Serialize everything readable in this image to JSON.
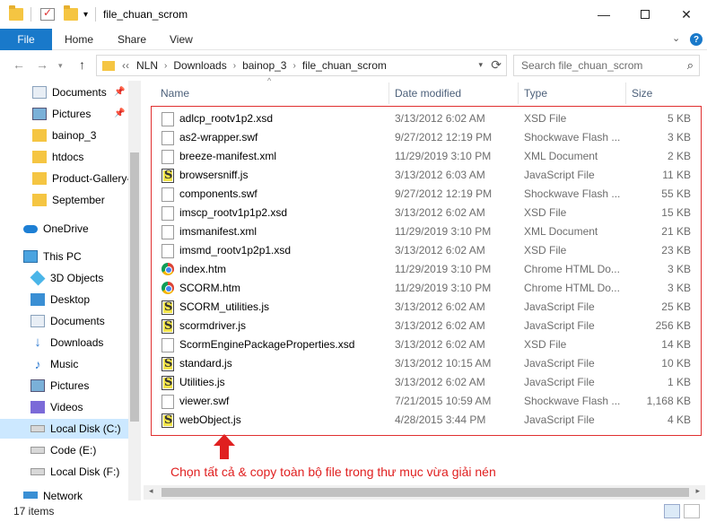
{
  "window": {
    "title": "file_chuan_scrom",
    "controls": {
      "minimize": "—",
      "close": "✕"
    }
  },
  "ribbon": {
    "file": "File",
    "tabs": [
      "Home",
      "Share",
      "View"
    ],
    "expand_icon": "chevron-down-icon",
    "help": "?"
  },
  "address": {
    "overflow": "‹‹",
    "crumbs": [
      "NLN",
      "Downloads",
      "bainop_3",
      "file_chuan_scrom"
    ]
  },
  "search": {
    "placeholder": "Search file_chuan_scrom"
  },
  "nav": {
    "items": [
      {
        "label": "Documents",
        "icon": "documents-icon",
        "pinned": true
      },
      {
        "label": "Pictures",
        "icon": "pictures-icon",
        "pinned": true
      },
      {
        "label": "bainop_3",
        "icon": "folder-icon"
      },
      {
        "label": "htdocs",
        "icon": "folder-icon"
      },
      {
        "label": "Product-Gallery-",
        "icon": "folder-icon"
      },
      {
        "label": "September",
        "icon": "folder-icon"
      },
      {
        "label": "OneDrive",
        "icon": "onedrive-icon"
      },
      {
        "label": "This PC",
        "icon": "this-pc-icon"
      },
      {
        "label": "3D Objects",
        "icon": "3d-objects-icon"
      },
      {
        "label": "Desktop",
        "icon": "desktop-icon"
      },
      {
        "label": "Documents",
        "icon": "documents-icon"
      },
      {
        "label": "Downloads",
        "icon": "downloads-icon"
      },
      {
        "label": "Music",
        "icon": "music-icon"
      },
      {
        "label": "Pictures",
        "icon": "pictures-icon"
      },
      {
        "label": "Videos",
        "icon": "videos-icon"
      },
      {
        "label": "Local Disk (C:)",
        "icon": "disk-icon",
        "selected": true
      },
      {
        "label": "Code (E:)",
        "icon": "disk-icon"
      },
      {
        "label": "Local Disk (F:)",
        "icon": "disk-icon"
      },
      {
        "label": "Network",
        "icon": "network-icon"
      }
    ]
  },
  "columns": {
    "name": "Name",
    "date": "Date modified",
    "type": "Type",
    "size": "Size"
  },
  "files": [
    {
      "name": "adlcp_rootv1p2.xsd",
      "date": "3/13/2012 6:02 AM",
      "type": "XSD File",
      "size": "5 KB",
      "icon": "document-icon"
    },
    {
      "name": "as2-wrapper.swf",
      "date": "9/27/2012 12:19 PM",
      "type": "Shockwave Flash ...",
      "size": "3 KB",
      "icon": "document-icon"
    },
    {
      "name": "breeze-manifest.xml",
      "date": "11/29/2019 3:10 PM",
      "type": "XML Document",
      "size": "2 KB",
      "icon": "document-icon"
    },
    {
      "name": "browsersniff.js",
      "date": "3/13/2012 6:03 AM",
      "type": "JavaScript File",
      "size": "11 KB",
      "icon": "js-file-icon"
    },
    {
      "name": "components.swf",
      "date": "9/27/2012 12:19 PM",
      "type": "Shockwave Flash ...",
      "size": "55 KB",
      "icon": "document-icon"
    },
    {
      "name": "imscp_rootv1p1p2.xsd",
      "date": "3/13/2012 6:02 AM",
      "type": "XSD File",
      "size": "15 KB",
      "icon": "document-icon"
    },
    {
      "name": "imsmanifest.xml",
      "date": "11/29/2019 3:10 PM",
      "type": "XML Document",
      "size": "21 KB",
      "icon": "document-icon"
    },
    {
      "name": "imsmd_rootv1p2p1.xsd",
      "date": "3/13/2012 6:02 AM",
      "type": "XSD File",
      "size": "23 KB",
      "icon": "document-icon"
    },
    {
      "name": "index.htm",
      "date": "11/29/2019 3:10 PM",
      "type": "Chrome HTML Do...",
      "size": "3 KB",
      "icon": "chrome-icon"
    },
    {
      "name": "SCORM.htm",
      "date": "11/29/2019 3:10 PM",
      "type": "Chrome HTML Do...",
      "size": "3 KB",
      "icon": "chrome-icon"
    },
    {
      "name": "SCORM_utilities.js",
      "date": "3/13/2012 6:02 AM",
      "type": "JavaScript File",
      "size": "25 KB",
      "icon": "js-file-icon"
    },
    {
      "name": "scormdriver.js",
      "date": "3/13/2012 6:02 AM",
      "type": "JavaScript File",
      "size": "256 KB",
      "icon": "js-file-icon"
    },
    {
      "name": "ScormEnginePackageProperties.xsd",
      "date": "3/13/2012 6:02 AM",
      "type": "XSD File",
      "size": "14 KB",
      "icon": "document-icon"
    },
    {
      "name": "standard.js",
      "date": "3/13/2012 10:15 AM",
      "type": "JavaScript File",
      "size": "10 KB",
      "icon": "js-file-icon"
    },
    {
      "name": "Utilities.js",
      "date": "3/13/2012 6:02 AM",
      "type": "JavaScript File",
      "size": "1 KB",
      "icon": "js-file-icon"
    },
    {
      "name": "viewer.swf",
      "date": "7/21/2015 10:59 AM",
      "type": "Shockwave Flash ...",
      "size": "1,168 KB",
      "icon": "document-icon"
    },
    {
      "name": "webObject.js",
      "date": "4/28/2015 3:44 PM",
      "type": "JavaScript File",
      "size": "4 KB",
      "icon": "js-file-icon"
    }
  ],
  "annotation": "Chọn tất cả & copy toàn bộ file trong thư mục vừa giải nén",
  "status": {
    "count": "17 items"
  },
  "colors": {
    "accent": "#1979ca",
    "annotation": "#e02020",
    "selection": "#cce8ff"
  }
}
